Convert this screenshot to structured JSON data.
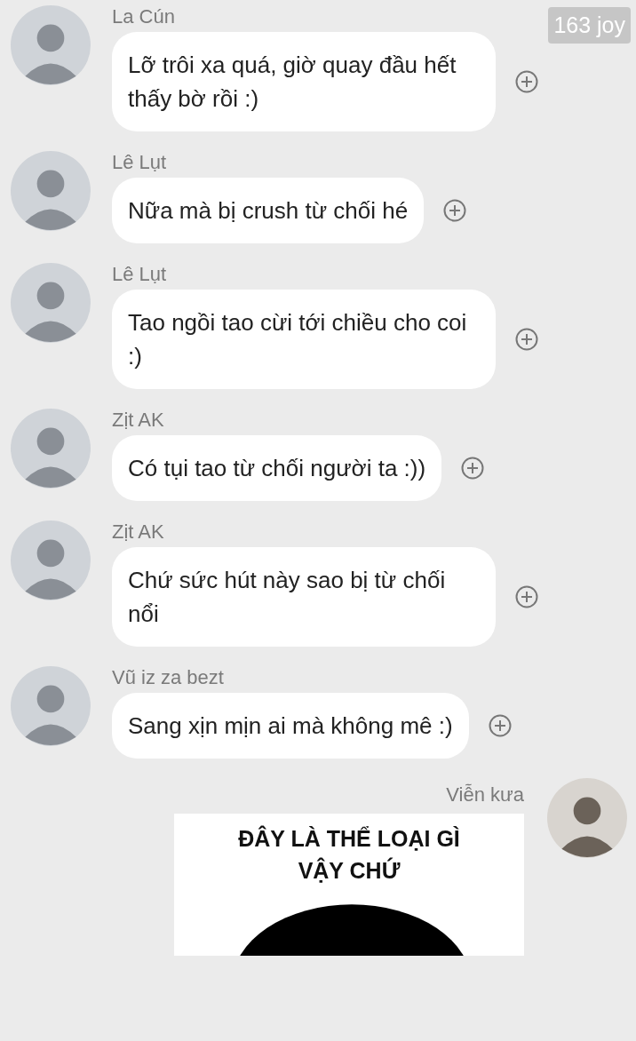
{
  "badge": "163 joy",
  "messages": [
    {
      "sender": "La Cún",
      "text": "Lỡ trôi xa quá, giờ quay đầu hết thấy bờ rồi :)"
    },
    {
      "sender": "Lê Lụt",
      "text": "Nữa mà bị crush từ chối hé"
    },
    {
      "sender": "Lê Lụt",
      "text": "Tao ngồi tao cừi tới chiều cho coi :)"
    },
    {
      "sender": "Zịt AK",
      "text": "Có tụi tao từ chối người ta :))"
    },
    {
      "sender": "Zịt AK",
      "text": "Chứ sức hút này sao bị từ chối nổi"
    },
    {
      "sender": "Vũ iz za bezt",
      "text": "Sang xịn mịn ai mà không mê :)"
    }
  ],
  "own_message": {
    "sender": "Viễn kưa",
    "caption": "ĐÂY LÀ THỂ LOẠI GÌ VẬY CHỨ"
  }
}
